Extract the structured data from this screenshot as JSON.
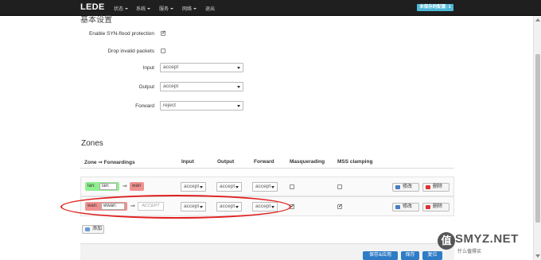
{
  "nav": {
    "brand": "LEDE",
    "menus": [
      "状态",
      "系统",
      "服务",
      "网络"
    ],
    "logout": "退出",
    "unsaved": "未保存的配置: 1"
  },
  "general": {
    "heading": "基本设置",
    "syn_flood_label": "Enable SYN-flood protection",
    "drop_invalid_label": "Drop invalid packets",
    "input_label": "Input",
    "input_value": "accept",
    "output_label": "Output",
    "output_value": "accept",
    "forward_label": "Forward",
    "forward_value": "reject"
  },
  "zones": {
    "title": "Zones",
    "headers": [
      "Zone ⇒ Forwardings",
      "Input",
      "Output",
      "Forward",
      "Masquerading",
      "MSS clamping"
    ],
    "rows": [
      {
        "zone_name": "lan:",
        "zone_net": "lan:",
        "arrow": "⇒",
        "dest": "wan",
        "input": "accept",
        "output": "accept",
        "forward": "accept",
        "masq": false,
        "mss": false
      },
      {
        "zone_name": "wan:",
        "zone_net": "wwan:",
        "arrow": "⇒",
        "dest": "ACCEPT",
        "input": "accept",
        "output": "accept",
        "forward": "accept",
        "masq": true,
        "mss": true
      }
    ],
    "edit_label": "修改",
    "delete_label": "删除",
    "add_label": "添加"
  },
  "footer": {
    "save_apply": "保存&应用",
    "save": "保存",
    "reset": "复位"
  },
  "watermark": {
    "badge": "值",
    "text": "SMYZ.NET",
    "sub": "什么值得买"
  }
}
